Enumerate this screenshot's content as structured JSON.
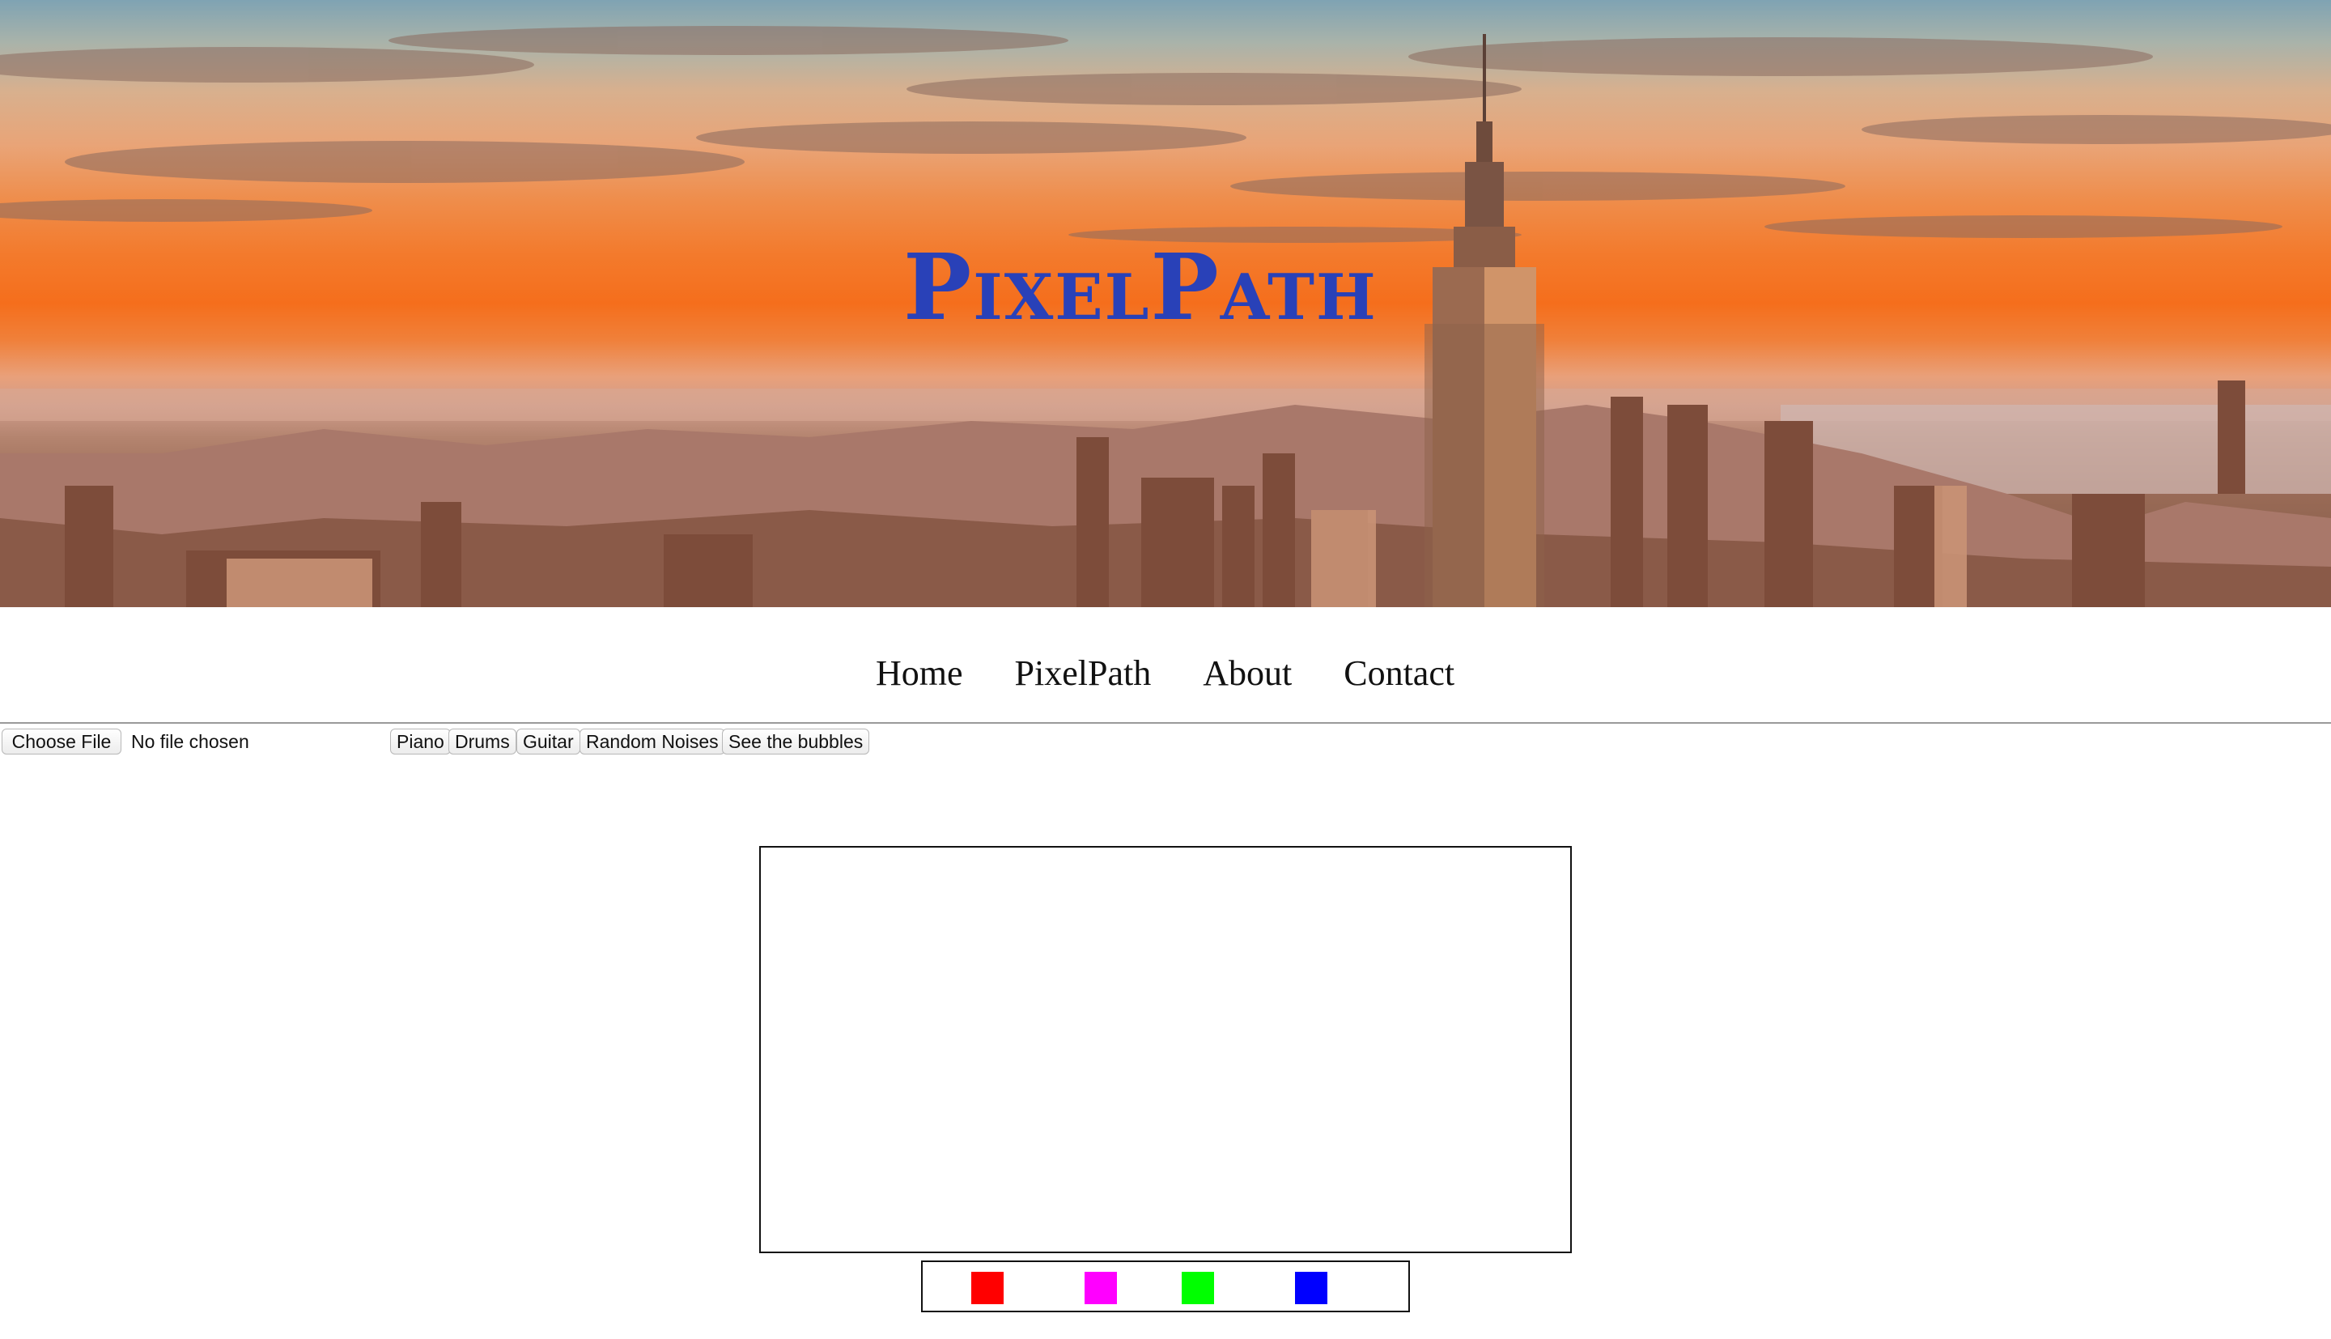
{
  "hero": {
    "title": "PixelPath"
  },
  "nav": {
    "items": [
      {
        "label": "Home"
      },
      {
        "label": "PixelPath"
      },
      {
        "label": "About"
      },
      {
        "label": "Contact"
      }
    ]
  },
  "controls": {
    "file_button_label": "Choose File",
    "file_status": "No file chosen",
    "buttons": [
      {
        "label": "Piano"
      },
      {
        "label": "Drums"
      },
      {
        "label": "Guitar"
      },
      {
        "label": "Random Noises"
      },
      {
        "label": "See the bubbles"
      }
    ]
  },
  "palette": {
    "colors": [
      {
        "name": "red",
        "hex": "#ff0000"
      },
      {
        "name": "magenta",
        "hex": "#ff00ff"
      },
      {
        "name": "green",
        "hex": "#00ff00"
      },
      {
        "name": "blue",
        "hex": "#0000ff"
      }
    ]
  },
  "colors": {
    "title": "#2941b8",
    "nav_text": "#111111",
    "divider": "#9a9a9a"
  }
}
